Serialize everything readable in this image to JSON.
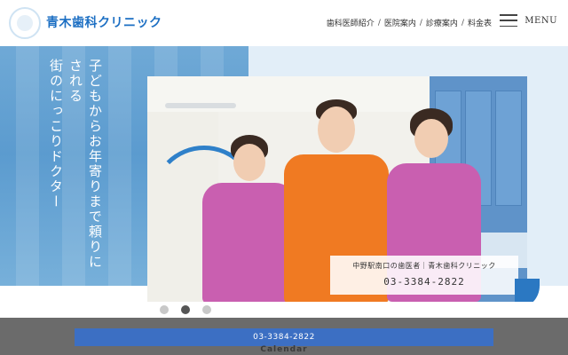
{
  "header": {
    "logo_text": "青木歯科クリニック",
    "nav": [
      {
        "label": "歯科医師紹介"
      },
      {
        "label": "医院案内"
      },
      {
        "label": "診療案内"
      },
      {
        "label": "料金表"
      }
    ],
    "nav_separator": "/",
    "menu_label": "MENU",
    "menu_icon": "hamburger-icon"
  },
  "hero": {
    "catch_line1": "子どもからお年寄りまで頼りにされる",
    "catch_line2": "街のにっこりドクター",
    "caption_line1": "中野駅南口の歯医者｜青木歯科クリニック",
    "caption_phone": "03-3384-2822",
    "slides_total": 3,
    "slide_active": 2
  },
  "footer": {
    "tel_button": "03-3384-2822",
    "calendar_label": "Calendar"
  },
  "colors": {
    "brand_blue": "#1c6fc3",
    "hero_left_blue": "#5b9bcf",
    "tel_bar": "#3c6fc3",
    "footer_gray": "#6b6b6b"
  }
}
